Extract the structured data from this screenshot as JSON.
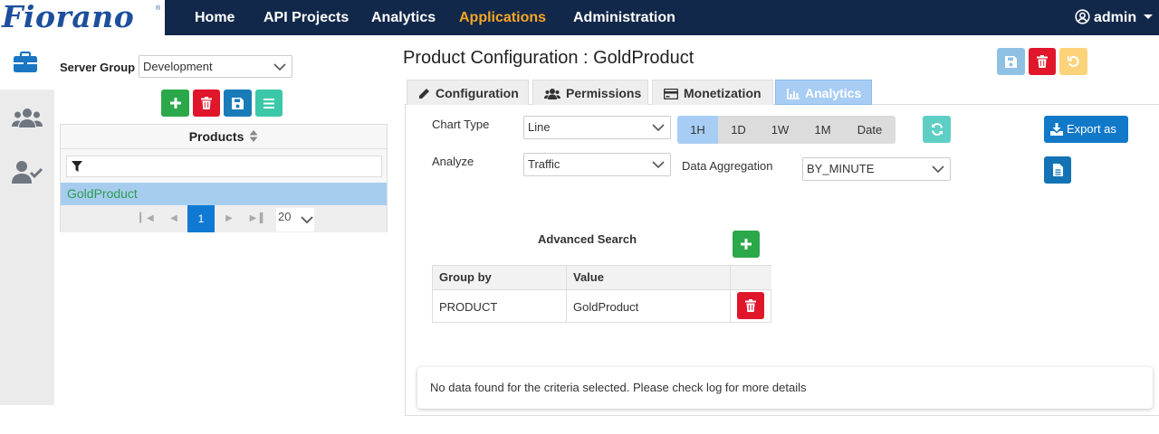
{
  "logo": {
    "text": "Fiorano",
    "mark": "®"
  },
  "nav": {
    "items": [
      {
        "label": "Home"
      },
      {
        "label": "API Projects"
      },
      {
        "label": "Analytics"
      },
      {
        "label": "Applications",
        "active": true
      },
      {
        "label": "Administration"
      }
    ],
    "user": "admin",
    "active_color": "#f5a623",
    "bar_color": "#12284a"
  },
  "rail": {
    "icons": [
      "briefcase-icon",
      "users-icon",
      "user-check-icon"
    ]
  },
  "products_panel": {
    "server_group_label": "Server Group",
    "server_group_value": "Development",
    "buttons": [
      "plus-icon",
      "trash-icon",
      "save-icon",
      "list-icon"
    ],
    "table_header": "Products",
    "filter_placeholder": "",
    "rows": [
      "GoldProduct"
    ],
    "pagination": {
      "current_page": "1",
      "page_size": "20"
    }
  },
  "main": {
    "title": "Product Configuration : GoldProduct",
    "header_buttons": [
      "save-icon",
      "trash-icon",
      "undo-icon"
    ],
    "tabs": [
      {
        "label": "Configuration",
        "icon": "pencil-icon"
      },
      {
        "label": "Permissions",
        "icon": "users-icon"
      },
      {
        "label": "Monetization",
        "icon": "credit-card-icon"
      },
      {
        "label": "Analytics",
        "icon": "chart-icon",
        "active": true
      }
    ],
    "chart_type_label": "Chart Type",
    "chart_type_value": "Line",
    "analyze_label": "Analyze",
    "analyze_value": "Traffic",
    "time_ranges": [
      "1H",
      "1D",
      "1W",
      "1M",
      "Date"
    ],
    "selected_range": "1H",
    "data_aggregation_label": "Data Aggregation",
    "data_aggregation_value": "BY_MINUTE",
    "export_label": "Export as",
    "advanced_search_label": "Advanced Search",
    "group_table": {
      "headers": [
        "Group by",
        "Value"
      ],
      "rows": [
        {
          "group_by": "PRODUCT",
          "value": "GoldProduct"
        }
      ]
    },
    "message": "No data found for the criteria selected. Please check log for more details"
  }
}
